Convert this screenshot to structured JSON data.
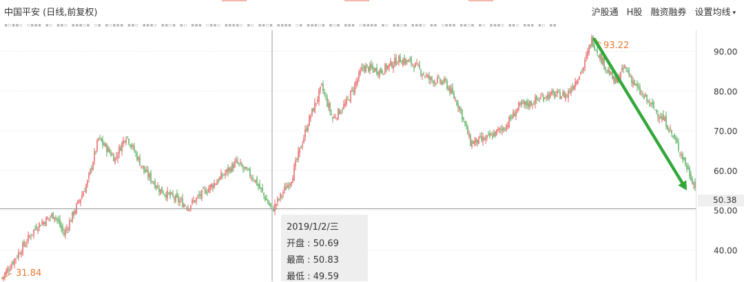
{
  "header": {
    "title": "中国平安 (日线,前复权)",
    "menu": [
      "沪股通",
      "H股",
      "融资融券",
      "设置均线"
    ]
  },
  "marker_row": "▪▫▪▪▫ ▫▪▪▪ ▪▫ ▪▪▫ ▪▪▪▫▪ ▫▪ ▪▫▪▪▪ ▪▪▫ ▪▪▪▫ ▪▪▫▪ ▪▫ ▪▪▪ ▫▪▪▫ ▪▪▪▪▫ ▪▫ ▪▪▫▪ ▪▪▪▪ ▫▪ ▪▪▪▫▪ ▪▫▪ ▪▪▪ ▫▪▪▪▪ ▪▫ ▪▪▫▪ ▪▪▪▫ ▪▪ ▫▪▪▪ ▪▪▫▪ ▪▫ ▪▪▪▫ ▪▪▫ ▪▪▪ ▪▫ ▪▪",
  "colors": {
    "up": "#e03b3b",
    "down": "#2f9a35",
    "annotation": "#e8782c",
    "arrow": "#33a73a",
    "grid": "#e2e2e2",
    "crosshair": "#999999"
  },
  "chart_data": {
    "type": "candlestick",
    "symbol": "中国平安",
    "y_axis": {
      "ticks": [
        40,
        50,
        60,
        70,
        80,
        90
      ],
      "tick_labels": [
        "40.00",
        "50.00",
        "60.00",
        "70.00",
        "80.00",
        "90.00"
      ],
      "range": [
        36,
        97
      ]
    },
    "annotations": {
      "low_label": "31.84",
      "high_label": "93.22",
      "current_price_label": "50.38",
      "current_price": 50.38
    },
    "arrow": {
      "from_value": 93.0,
      "to_value": 55.0
    },
    "trend_points": [
      {
        "i": 0,
        "v": 33
      },
      {
        "i": 25,
        "v": 46
      },
      {
        "i": 38,
        "v": 49
      },
      {
        "i": 45,
        "v": 44
      },
      {
        "i": 62,
        "v": 57
      },
      {
        "i": 70,
        "v": 68
      },
      {
        "i": 82,
        "v": 63
      },
      {
        "i": 90,
        "v": 69
      },
      {
        "i": 103,
        "v": 60
      },
      {
        "i": 115,
        "v": 55
      },
      {
        "i": 135,
        "v": 51
      },
      {
        "i": 148,
        "v": 55
      },
      {
        "i": 158,
        "v": 58
      },
      {
        "i": 170,
        "v": 62
      },
      {
        "i": 183,
        "v": 58
      },
      {
        "i": 196,
        "v": 50
      },
      {
        "i": 210,
        "v": 58
      },
      {
        "i": 222,
        "v": 72
      },
      {
        "i": 232,
        "v": 81
      },
      {
        "i": 240,
        "v": 73
      },
      {
        "i": 250,
        "v": 77
      },
      {
        "i": 262,
        "v": 86
      },
      {
        "i": 275,
        "v": 85
      },
      {
        "i": 288,
        "v": 88
      },
      {
        "i": 298,
        "v": 87
      },
      {
        "i": 310,
        "v": 83
      },
      {
        "i": 322,
        "v": 82
      },
      {
        "i": 332,
        "v": 76
      },
      {
        "i": 340,
        "v": 67
      },
      {
        "i": 352,
        "v": 68
      },
      {
        "i": 365,
        "v": 71
      },
      {
        "i": 375,
        "v": 76
      },
      {
        "i": 384,
        "v": 77
      },
      {
        "i": 395,
        "v": 79
      },
      {
        "i": 410,
        "v": 79
      },
      {
        "i": 422,
        "v": 86
      },
      {
        "i": 428,
        "v": 93
      },
      {
        "i": 435,
        "v": 88
      },
      {
        "i": 445,
        "v": 82
      },
      {
        "i": 452,
        "v": 86
      },
      {
        "i": 462,
        "v": 80
      },
      {
        "i": 472,
        "v": 76
      },
      {
        "i": 482,
        "v": 72
      },
      {
        "i": 492,
        "v": 65
      },
      {
        "i": 498,
        "v": 60
      },
      {
        "i": 503,
        "v": 56
      }
    ],
    "crosshair": {
      "candle_index": 196,
      "value": 50.38
    }
  },
  "tooltip": {
    "date": "2019/1/2/三",
    "open": "开盘 : 50.69",
    "high": "最高 : 50.83",
    "low": "最低 : 49.59"
  }
}
